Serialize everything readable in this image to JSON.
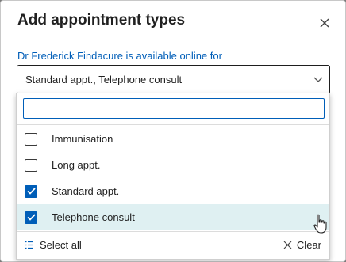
{
  "dialog": {
    "title": "Add appointment types",
    "field_label": "Dr Frederick Findacure is available online for",
    "selected_value": "Standard appt., Telephone consult"
  },
  "dropdown": {
    "search": {
      "value": "",
      "placeholder": ""
    },
    "options": [
      {
        "label": "Immunisation",
        "checked": false
      },
      {
        "label": "Long appt.",
        "checked": false
      },
      {
        "label": "Standard appt.",
        "checked": true
      },
      {
        "label": "Telephone consult",
        "checked": true
      }
    ],
    "hovered_option": "Telephone consult",
    "select_all_label": "Select all",
    "clear_label": "Clear"
  },
  "colors": {
    "accent": "#005eb8",
    "hover_row": "#dff0f2",
    "backdrop": "#7a7a7a"
  },
  "icons": {
    "close": "close-icon",
    "chevron": "chevron-down-icon",
    "checkmark": "checkmark-icon",
    "select_all": "list-check-icon",
    "clear": "clear-x-icon",
    "cursor": "hand-pointer-icon"
  }
}
